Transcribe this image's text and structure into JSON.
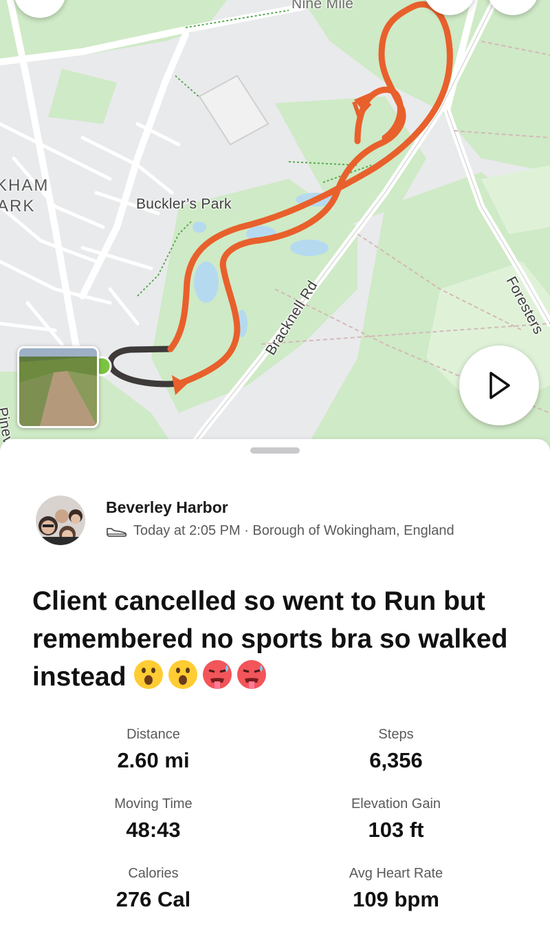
{
  "map": {
    "labels": {
      "road_top": "Nine Mile",
      "area_left_1": "KHAM",
      "area_left_2": "ARK",
      "park": "Buckler’s Park",
      "road_bracknell": "Bracknell Rd",
      "road_foresters": "Foresters",
      "road_left": "Pinev"
    },
    "colors": {
      "route": "#e8602c",
      "route_dark": "#3e3a39",
      "start_dot": "#7cc342",
      "park_green": "#c9e8c0",
      "water": "#b5daf0"
    }
  },
  "controls": {
    "play_icon": "play-icon",
    "back_icon": "back-icon",
    "top_right_icons": [
      "share-icon",
      "more-icon"
    ]
  },
  "activity": {
    "athlete_name": "Beverley Harbor",
    "sport_icon": "shoe-icon",
    "meta": "Today at 2:05 PM · Borough of Wokingham, England",
    "title": "Client cancelled so went to Run but remembered no sports bra so walked instead",
    "title_emojis": [
      "hushed-face",
      "hushed-face",
      "hot-face",
      "hot-face"
    ],
    "stats": [
      {
        "label": "Distance",
        "value": "2.60 mi"
      },
      {
        "label": "Steps",
        "value": "6,356"
      },
      {
        "label": "Moving Time",
        "value": "48:43"
      },
      {
        "label": "Elevation Gain",
        "value": "103 ft"
      },
      {
        "label": "Calories",
        "value": "276 Cal"
      },
      {
        "label": "Avg Heart Rate",
        "value": "109 bpm"
      }
    ]
  }
}
